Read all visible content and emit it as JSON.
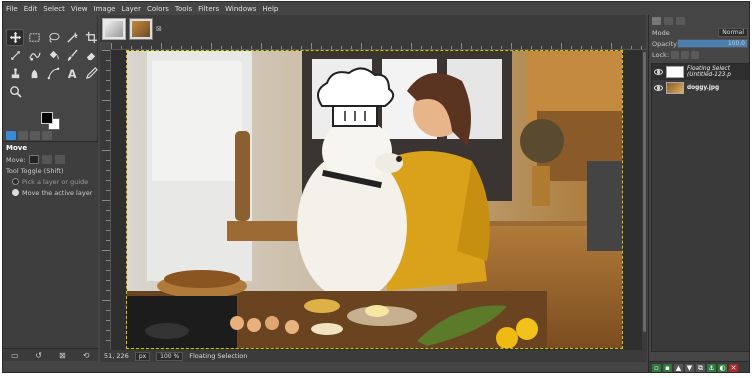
{
  "menu": [
    "File",
    "Edit",
    "Select",
    "View",
    "Image",
    "Layer",
    "Colors",
    "Tools",
    "Filters",
    "Windows",
    "Help"
  ],
  "tool_options": {
    "title": "Move",
    "move_label": "Move:",
    "toggle_label": "Tool Toggle  (Shift)",
    "option_pick": "Pick a layer or guide",
    "option_move": "Move the active layer"
  },
  "status": {
    "coords": "51, 226",
    "unit": "px",
    "zoom": "100 %",
    "message": "Floating Selection"
  },
  "layers_panel": {
    "mode_label": "Mode",
    "mode_value": "Normal",
    "opacity_label": "Opacity",
    "opacity_value": "100.0",
    "opacity_fraction": 1.0,
    "lock_label": "Lock:",
    "layers": [
      {
        "name_line1": "Floating Select",
        "name_line2": "(Untitled-123.p",
        "italic": true
      },
      {
        "name_line1": "doggy.jpg",
        "name_line2": "",
        "italic": false
      }
    ]
  },
  "colors": {
    "accent": "#3a88d6",
    "foreground": "#000000",
    "background": "#ffffff",
    "selection": "#d8c800"
  }
}
